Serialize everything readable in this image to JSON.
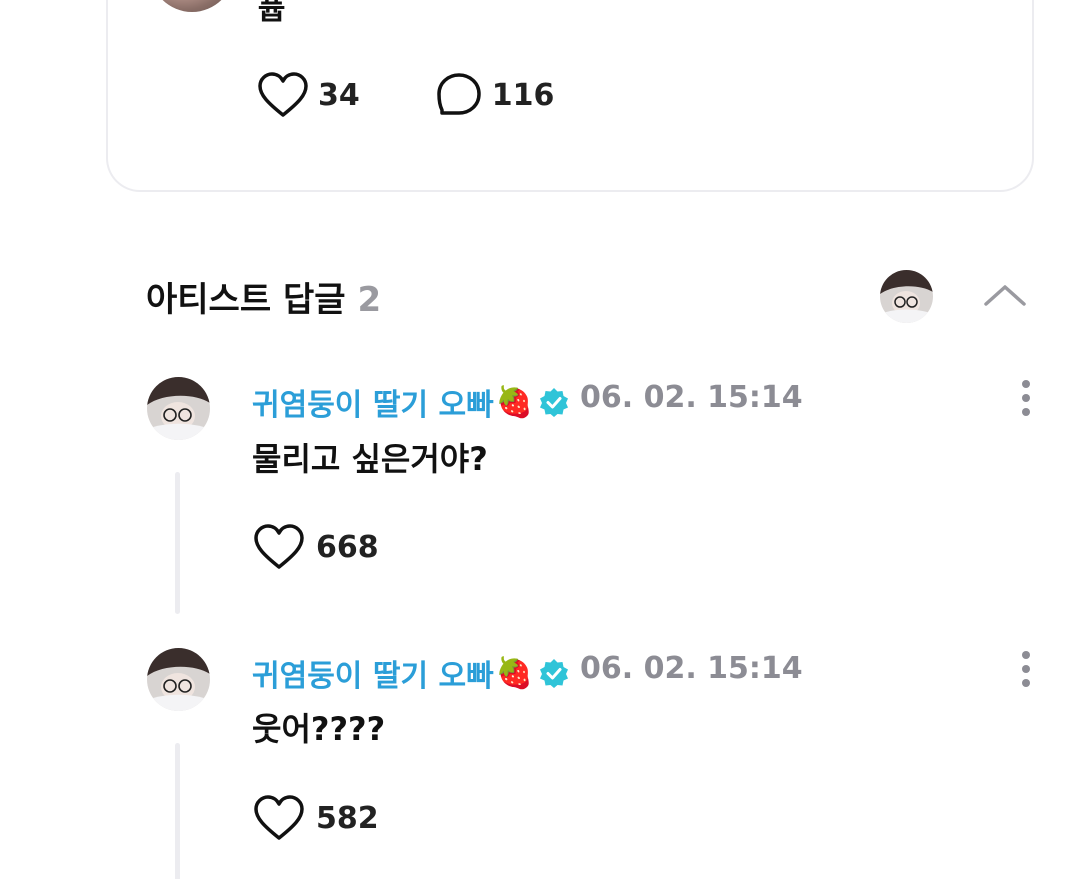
{
  "post": {
    "text": "퓹",
    "likes": "34",
    "comments": "116"
  },
  "replies_section": {
    "title": "아티스트 답글",
    "count": "2"
  },
  "replies": [
    {
      "author": "귀염둥이 딸기 오빠",
      "author_emoji": "🍓",
      "date": "06. 02. 15:14",
      "text": "물리고 싶은거야?",
      "likes": "668"
    },
    {
      "author": "귀염둥이 딸기 오빠",
      "author_emoji": "🍓",
      "date": "06. 02. 15:14",
      "text": "웃어????",
      "likes": "582"
    }
  ],
  "colors": {
    "author_name": "#2b9ed8",
    "verified_badge": "#2fc4d8",
    "date": "#8c8c94",
    "thread_line": "#ececf0",
    "card_border": "#ececf0"
  },
  "icons": {
    "like": "heart-outline-icon",
    "comment": "speech-bubble-icon",
    "verified": "verified-check-icon",
    "more": "more-vertical-icon",
    "collapse": "chevron-up-icon"
  }
}
